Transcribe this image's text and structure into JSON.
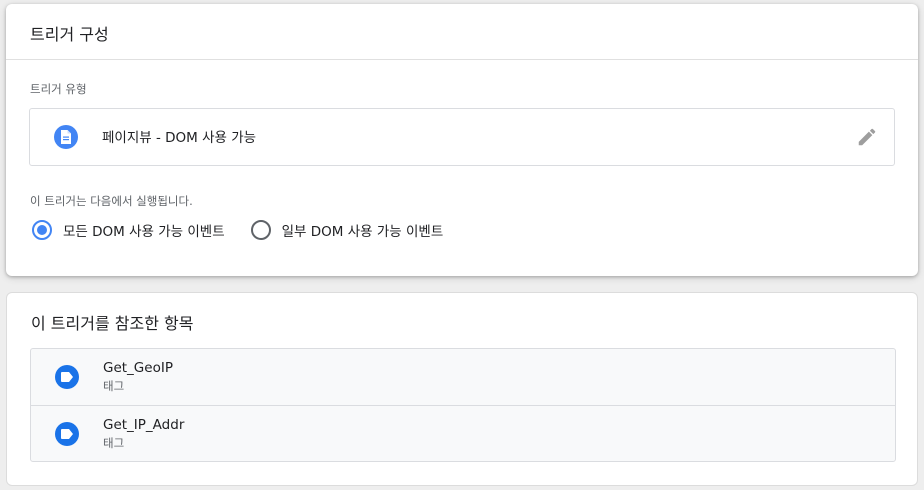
{
  "trigger_config": {
    "title": "트리거 구성",
    "type_label": "트리거 유형",
    "type_name": "페이지뷰 - DOM 사용 가능",
    "type_icon": "document-icon",
    "edit_icon": "pencil-icon",
    "fires_on_label": "이 트리거는 다음에서 실행됩니다.",
    "fire_options": [
      {
        "label": "모든 DOM 사용 가능 이벤트",
        "selected": true
      },
      {
        "label": "일부 DOM 사용 가능 이벤트",
        "selected": false
      }
    ]
  },
  "references": {
    "title": "이 트리거를 참조한 항목",
    "items": [
      {
        "name": "Get_GeoIP",
        "type": "태그",
        "icon": "tag-icon"
      },
      {
        "name": "Get_IP_Addr",
        "type": "태그",
        "icon": "tag-icon"
      }
    ]
  },
  "colors": {
    "accent": "#4285f4",
    "background": "#eeeeee",
    "card": "#ffffff"
  }
}
